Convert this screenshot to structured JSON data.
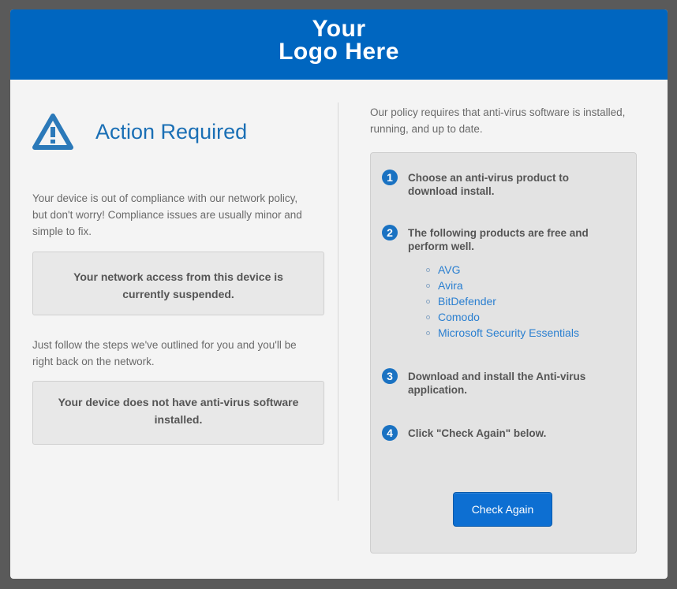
{
  "header": {
    "logo_line1": "Your",
    "logo_line2": "Logo Here"
  },
  "left": {
    "title": "Action Required",
    "intro": "Your device is out of compliance with our network policy, but don't worry! Compliance issues are usually minor and simple to fix.",
    "notice_access": "Your network access from this device is currently suspended.",
    "follow_text": "Just follow the steps we've outlined for you and you'll be right back on the network.",
    "notice_antivirus": "Your device does not have anti-virus software installed."
  },
  "right": {
    "intro": "Our policy requires that anti-virus software is installed, running, and up to date.",
    "steps": [
      {
        "num": "1",
        "text": "Choose an anti-virus product to download install."
      },
      {
        "num": "2",
        "text": "The following products are free and perform well."
      },
      {
        "num": "3",
        "text": "Download and install the Anti-virus application."
      },
      {
        "num": "4",
        "text": "Click \"Check Again\" below."
      }
    ],
    "products": [
      "AVG",
      "Avira",
      "BitDefender",
      "Comodo",
      "Microsoft Security Essentials"
    ],
    "check_again_label": "Check Again"
  },
  "colors": {
    "header_blue": "#0066c0",
    "accent_blue": "#1a6fb5",
    "link_blue": "#2a7fd0",
    "button_blue": "#0d6fd2"
  },
  "icons": {
    "warning": "warning-triangle-icon"
  }
}
